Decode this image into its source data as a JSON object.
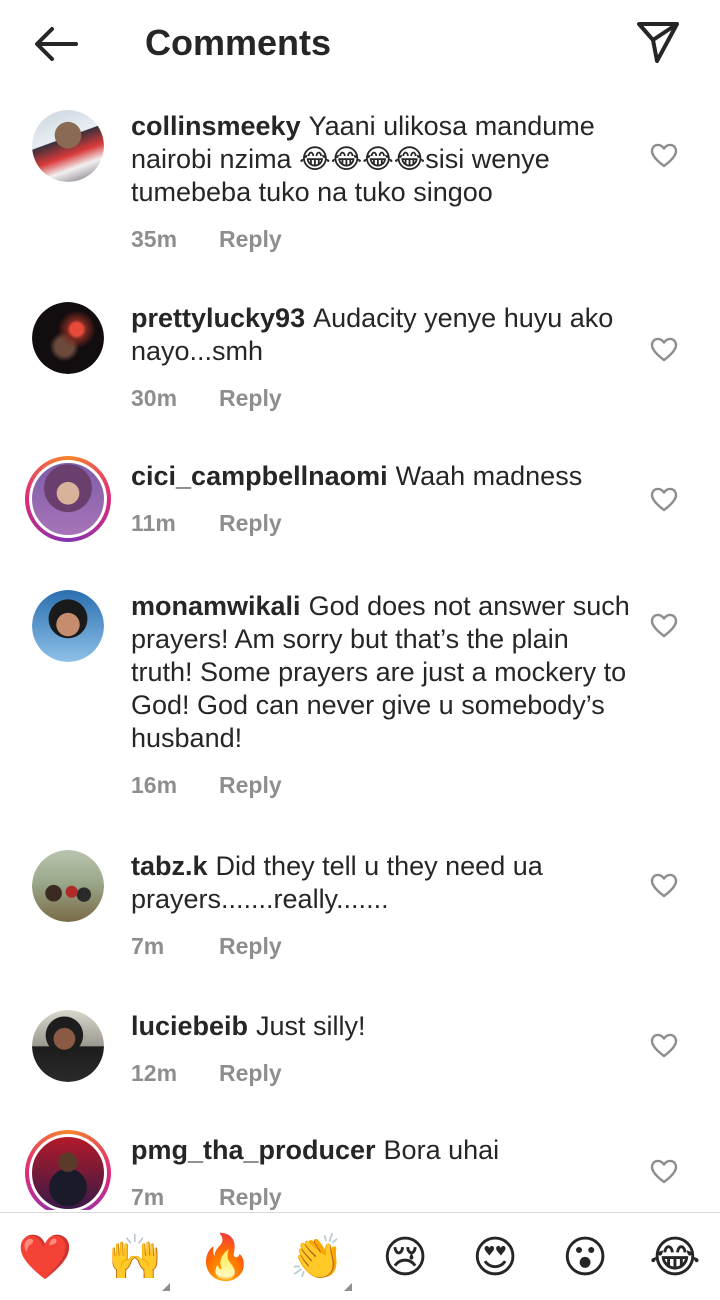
{
  "header": {
    "title": "Comments"
  },
  "comments": [
    {
      "username": "collinsmeeky",
      "text": "Yaani ulikosa mandume nairobi nzima 😂😂😂😂sisi wenye tumebeba tuko na tuko singoo",
      "time": "35m",
      "reply": "Reply"
    },
    {
      "username": "prettylucky93",
      "text": "Audacity yenye huyu ako nayo...smh",
      "time": "30m",
      "reply": "Reply"
    },
    {
      "username": "cici_campbellnaomi",
      "text": "Waah madness",
      "time": "11m",
      "reply": "Reply"
    },
    {
      "username": "monamwikali",
      "text": "God does not answer such prayers! Am sorry but that’s the plain truth! Some prayers are just a mockery to God! God can never give u somebody’s husband!",
      "time": "16m",
      "reply": "Reply"
    },
    {
      "username": "tabz.k",
      "text": "Did they tell u they need ua prayers.......really.......",
      "time": "7m",
      "reply": "Reply"
    },
    {
      "username": "luciebeib",
      "text": "Just silly!",
      "time": "12m",
      "reply": "Reply"
    },
    {
      "username": "pmg_tha_producer",
      "text": "Bora uhai",
      "time": "7m",
      "reply": "Reply"
    }
  ],
  "reactions": [
    "❤️",
    "🙌",
    "🔥",
    "👏",
    "😢",
    "😍",
    "😮",
    "😂"
  ],
  "icons": {
    "back": "arrow-left-icon",
    "share": "paper-plane-icon",
    "like": "heart-outline-icon"
  }
}
